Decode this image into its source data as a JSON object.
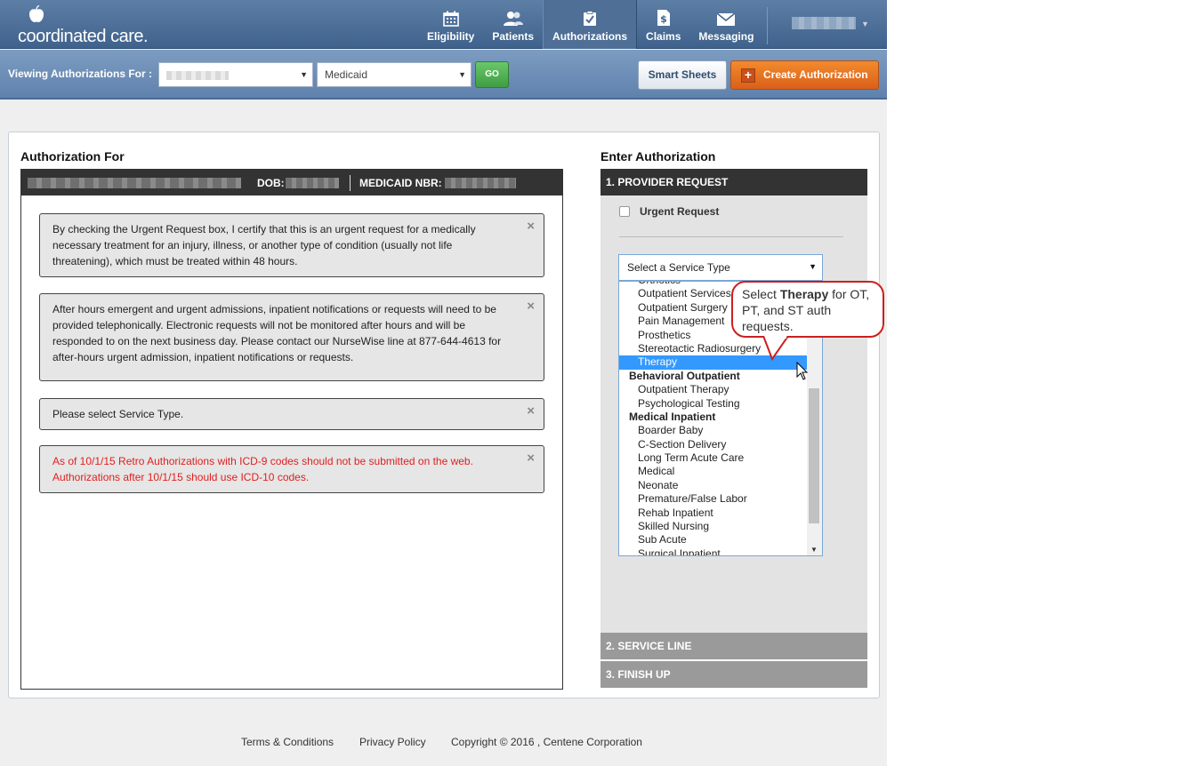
{
  "brand": {
    "name": "coordinated care.",
    "logo_icon": "apple-icon"
  },
  "nav": [
    {
      "label": "Eligibility",
      "icon": "calendar-icon"
    },
    {
      "label": "Patients",
      "icon": "people-icon"
    },
    {
      "label": "Authorizations",
      "icon": "checkmark-clipboard-icon",
      "active": true
    },
    {
      "label": "Claims",
      "icon": "dollar-document-icon"
    },
    {
      "label": "Messaging",
      "icon": "envelope-icon"
    }
  ],
  "subheader": {
    "viewing_label": "Viewing Authorizations For :",
    "plan_value": "Medicaid",
    "go_label": "GO",
    "smart_sheets_label": "Smart Sheets",
    "create_label": "Create Authorization"
  },
  "left": {
    "heading": "Authorization For",
    "dob_label": "DOB:",
    "medicaid_label": "MEDICAID NBR:",
    "alerts": [
      {
        "text": "By checking the Urgent Request box, I certify that this is an urgent request for a medically necessary treatment for an injury, illness, or another type of condition (usually not life threatening), which must be treated within 48 hours."
      },
      {
        "text": "After hours emergent and urgent admissions, inpatient notifications or requests will need to be provided telephonically. Electronic requests will not be monitored after hours and will be responded to on the next business day. Please contact our NurseWise line at 877-644-4613 for after-hours urgent admission, inpatient notifications or requests."
      },
      {
        "text": "Please select Service Type."
      },
      {
        "text": "As of 10/1/15 Retro Authorizations with ICD-9 codes should not be submitted on the web. Authorizations after 10/1/15 should use ICD-10 codes.",
        "color": "#e02020"
      }
    ],
    "close_glyph": "×"
  },
  "right": {
    "heading": "Enter Authorization",
    "step1": "1. PROVIDER REQUEST",
    "urgent_label": "Urgent Request",
    "service_select": "Select a Service Type",
    "options": [
      {
        "label": "Orthotics"
      },
      {
        "label": "Outpatient Services"
      },
      {
        "label": "Outpatient Surgery"
      },
      {
        "label": "Pain Management"
      },
      {
        "label": "Prosthetics"
      },
      {
        "label": "Stereotactic Radiosurgery"
      },
      {
        "label": "Therapy",
        "selected": true
      },
      {
        "label": "Behavioral Outpatient",
        "group": true
      },
      {
        "label": "Outpatient Therapy"
      },
      {
        "label": "Psychological Testing"
      },
      {
        "label": "Medical Inpatient",
        "group": true
      },
      {
        "label": "Boarder Baby"
      },
      {
        "label": "C-Section Delivery"
      },
      {
        "label": "Long Term Acute Care"
      },
      {
        "label": "Medical"
      },
      {
        "label": "Neonate"
      },
      {
        "label": "Premature/False Labor"
      },
      {
        "label": "Rehab Inpatient"
      },
      {
        "label": "Skilled Nursing"
      },
      {
        "label": "Sub Acute"
      },
      {
        "label": "Surgical Inpatient"
      }
    ],
    "callout": {
      "prefix": "Select ",
      "bold": "Therapy",
      "suffix": " for OT, PT, and ST auth requests."
    },
    "step2": "2. SERVICE LINE",
    "step3": "3. FINISH UP"
  },
  "footer": {
    "terms": "Terms & Conditions",
    "privacy": "Privacy Policy",
    "copyright": "Copyright © 2016 , Centene Corporation"
  },
  "colors": {
    "header_blue": "#3f628c",
    "go_green": "#3f9e41",
    "create_orange": "#d9601a",
    "selected_blue": "#3399ff",
    "callout_red": "#cc1f1f",
    "alert_red": "#e02020"
  }
}
